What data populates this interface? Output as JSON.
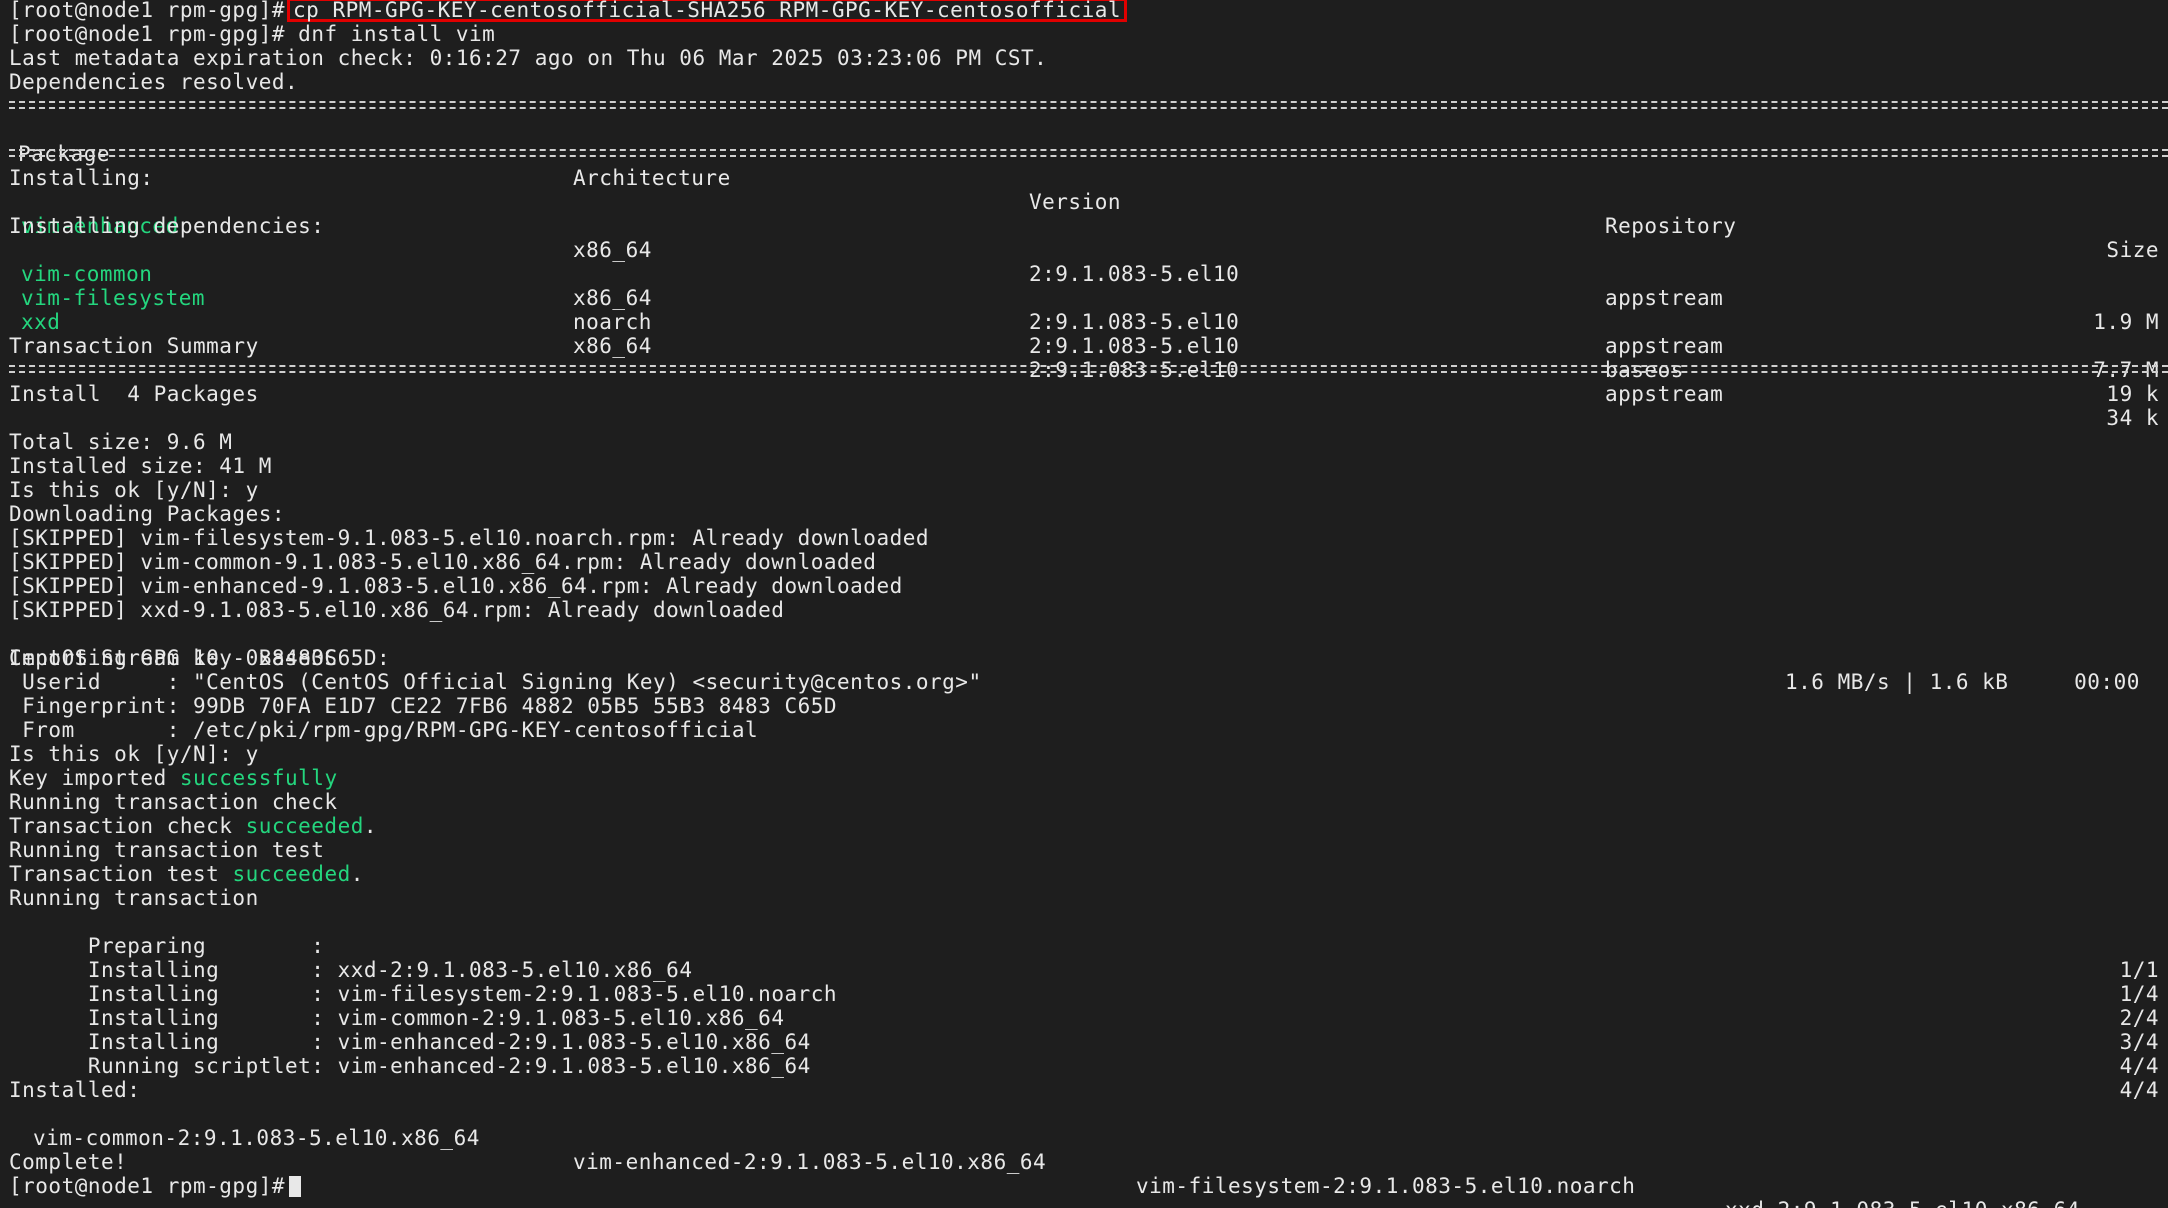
{
  "prompt": "[root@node1 rpm-gpg]#",
  "cmd1": "cp RPM-GPG-KEY-centosofficial-SHA256 RPM-GPG-KEY-centosofficial",
  "cmd2": "dnf install vim",
  "metadata_line": "Last metadata expiration check: 0:16:27 ago on Thu 06 Mar 2025 03:23:06 PM CST.",
  "deps_resolved": "Dependencies resolved.",
  "table": {
    "headers": [
      "Package",
      "Architecture",
      "Version",
      "Repository",
      "Size"
    ],
    "installing_label": "Installing:",
    "installing_deps_label": "Installing dependencies:",
    "rows": [
      {
        "name": "vim-enhanced",
        "arch": "x86_64",
        "version": "2:9.1.083-5.el10",
        "repo": "appstream",
        "size": "1.9 M"
      },
      {
        "name": "vim-common",
        "arch": "x86_64",
        "version": "2:9.1.083-5.el10",
        "repo": "appstream",
        "size": "7.7 M"
      },
      {
        "name": "vim-filesystem",
        "arch": "noarch",
        "version": "2:9.1.083-5.el10",
        "repo": "baseos",
        "size": "19 k"
      },
      {
        "name": "xxd",
        "arch": "x86_64",
        "version": "2:9.1.083-5.el10",
        "repo": "appstream",
        "size": "34 k"
      }
    ]
  },
  "transaction_summary": "Transaction Summary",
  "install_count": "Install  4 Packages",
  "total_size": "Total size: 9.6 M",
  "installed_size": "Installed size: 41 M",
  "confirm1": "Is this ok [y/N]: y",
  "downloading": "Downloading Packages:",
  "skipped": [
    "[SKIPPED] vim-filesystem-9.1.083-5.el10.noarch.rpm: Already downloaded",
    "[SKIPPED] vim-common-9.1.083-5.el10.x86_64.rpm: Already downloaded",
    "[SKIPPED] vim-enhanced-9.1.083-5.el10.x86_64.rpm: Already downloaded",
    "[SKIPPED] xxd-9.1.083-5.el10.x86_64.rpm: Already downloaded"
  ],
  "baseos_line": {
    "label": "CentOS Stream 10 - BaseOS",
    "speed": "1.6 MB/s | 1.6 kB     00:00"
  },
  "gpg": {
    "importing": "Importing GPG key 0x8483C65D:",
    "userid": " Userid     : \"CentOS (CentOS Official Signing Key) <security@centos.org>\"",
    "fingerprint": " Fingerprint: 99DB 70FA E1D7 CE22 7FB6 4882 05B5 55B3 8483 C65D",
    "from": " From       : /etc/pki/rpm-gpg/RPM-GPG-KEY-centosofficial"
  },
  "confirm2": "Is this ok [y/N]: y",
  "key_imported_prefix": "Key imported ",
  "key_imported_status": "successfully",
  "running_check": "Running transaction check",
  "check_prefix": "Transaction check ",
  "check_status": "succeeded",
  "check_suffix": ".",
  "running_test": "Running transaction test",
  "test_prefix": "Transaction test ",
  "test_status": "succeeded",
  "test_suffix": ".",
  "running_transaction": "Running transaction",
  "steps": [
    {
      "action": "  Preparing        :",
      "pkg": "",
      "count": "1/1"
    },
    {
      "action": "  Installing       :",
      "pkg": " xxd-2:9.1.083-5.el10.x86_64",
      "count": "1/4"
    },
    {
      "action": "  Installing       :",
      "pkg": " vim-filesystem-2:9.1.083-5.el10.noarch",
      "count": "2/4"
    },
    {
      "action": "  Installing       :",
      "pkg": " vim-common-2:9.1.083-5.el10.x86_64",
      "count": "3/4"
    },
    {
      "action": "  Installing       :",
      "pkg": " vim-enhanced-2:9.1.083-5.el10.x86_64",
      "count": "4/4"
    },
    {
      "action": "  Running scriptlet:",
      "pkg": " vim-enhanced-2:9.1.083-5.el10.x86_64",
      "count": "4/4"
    }
  ],
  "installed_label": "Installed:",
  "installed_pkgs": [
    "vim-common-2:9.1.083-5.el10.x86_64",
    "vim-enhanced-2:9.1.083-5.el10.x86_64",
    "vim-filesystem-2:9.1.083-5.el10.noarch",
    "xxd-2:9.1.083-5.el10.x86_64"
  ],
  "complete": "Complete!",
  "colors": {
    "background": "#1e1e1e",
    "foreground": "#e8e8e8",
    "success_green": "#24d67e",
    "highlight_red": "#e00000"
  }
}
